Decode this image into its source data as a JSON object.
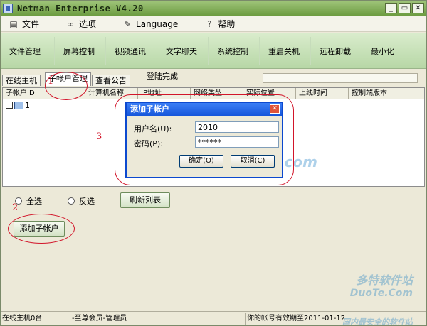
{
  "window": {
    "title": "Netman Enterprise V4.20",
    "buttons": [
      "_",
      "▭",
      "✕"
    ]
  },
  "menu": [
    {
      "icon": "document-icon",
      "glyph": "▤",
      "label": "文件"
    },
    {
      "icon": "glasses-icon",
      "glyph": "∞",
      "label": "选项"
    },
    {
      "icon": "pen-icon",
      "glyph": "✎",
      "label": "Language"
    },
    {
      "icon": "help-icon",
      "glyph": "?",
      "label": "帮助"
    }
  ],
  "toolbar": [
    "文件管理",
    "屏幕控制",
    "视频通讯",
    "文字聊天",
    "系统控制",
    "重启关机",
    "远程卸载",
    "最小化"
  ],
  "tabs": [
    "在线主机",
    "子帐户管理",
    "查看公告"
  ],
  "status_message": "登陆完成",
  "table": {
    "columns": [
      "子帐户ID",
      "计算机名称",
      "IP地址",
      "网络类型",
      "实际位置",
      "上线时间",
      "控制端版本"
    ],
    "rows": [
      {
        "id": "1"
      }
    ]
  },
  "controls": {
    "select_all": "全选",
    "invert": "反选",
    "refresh": "刷新列表",
    "add_subaccount": "添加子帐户"
  },
  "statusbar": [
    "在线主机0台",
    "-至尊会员-管理员",
    "你的帐号有效期至2011-01-12"
  ],
  "dialog": {
    "title": "添加子帐户",
    "username_label": "用户名(U):",
    "username_value": "2010",
    "password_label": "密码(P):",
    "password_value": "******",
    "ok_label": "确定(O)",
    "cancel_label": "取消(C)"
  },
  "annotations": [
    "1",
    "2",
    "3"
  ],
  "watermark": {
    "brand_cn": "多特软件站",
    "brand_en": "DuoTe.Com",
    "slogan": "国内最安全的软件站",
    "center": "www.DuoTe.com"
  },
  "colors": {
    "annotation": "#d2152a",
    "dialog_title": "#1656db",
    "toolbar": "#c8e2b8"
  }
}
